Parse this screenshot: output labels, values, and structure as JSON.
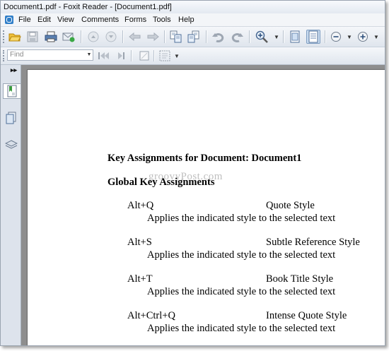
{
  "window": {
    "title": "Document1.pdf - Foxit Reader - [Document1.pdf]"
  },
  "menu": {
    "items": [
      "File",
      "Edit",
      "View",
      "Comments",
      "Forms",
      "Tools",
      "Help"
    ]
  },
  "find": {
    "placeholder": "Find"
  },
  "icons": {
    "toolbar": [
      "open-folder-icon",
      "save-icon",
      "print-icon",
      "email-icon",
      "previous-page-icon",
      "next-page-icon",
      "back-icon",
      "forward-icon",
      "extract-page-icon",
      "insert-page-icon",
      "undo-icon",
      "redo-icon",
      "zoom-in-tool-icon",
      "fit-width-icon",
      "fit-page-icon",
      "zoom-out-icon",
      "zoom-in-icon"
    ],
    "sidebar": [
      "bookmarks-icon",
      "pages-icon",
      "layers-icon"
    ]
  },
  "document": {
    "title": "Key Assignments for Document:  Document1",
    "section": "Global Key Assignments",
    "watermark": "groovyPost.com",
    "assignments": [
      {
        "keys": "Alt+Q",
        "style": "Quote Style",
        "description": "Applies the indicated style to the selected text"
      },
      {
        "keys": "Alt+S",
        "style": "Subtle Reference Style",
        "description": "Applies the indicated style to the selected text"
      },
      {
        "keys": "Alt+T",
        "style": "Book Title Style",
        "description": "Applies the indicated style to the selected text"
      },
      {
        "keys": "Alt+Ctrl+Q",
        "style": "Intense Quote Style",
        "description": "Applies the indicated style to the selected text"
      }
    ]
  }
}
